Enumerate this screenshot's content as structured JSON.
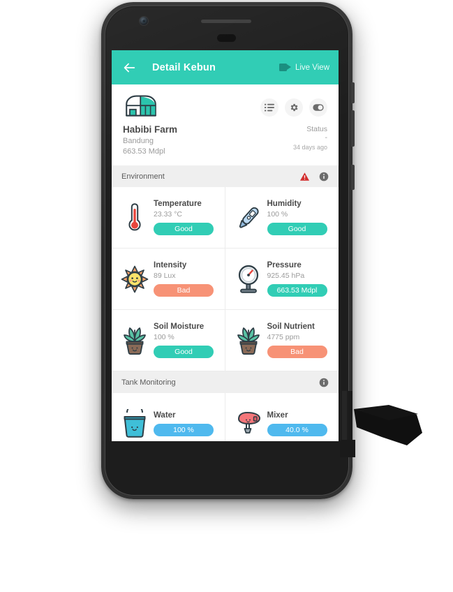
{
  "appbar": {
    "back_icon": "arrow-left-icon",
    "title": "Detail Kebun",
    "live_view_label": "Live View",
    "live_view_icon": "video-camera-icon",
    "bg_color": "#31CDB5"
  },
  "farm": {
    "logo_icon": "greenhouse-icon",
    "name": "Habibi Farm",
    "city": "Bandung",
    "altitude": "663.53 Mdpl",
    "status_label": "Status",
    "status_value": "-",
    "status_ago": "34 days ago",
    "actions": [
      {
        "name": "list-icon",
        "label": "list"
      },
      {
        "name": "gear-icon",
        "label": "settings"
      },
      {
        "name": "toggle-icon",
        "label": "toggle"
      }
    ]
  },
  "sections": [
    {
      "title": "Environment",
      "icons": [
        "warning-triangle-icon",
        "info-icon"
      ],
      "cards": [
        {
          "icon": "thermometer-icon",
          "name": "Temperature",
          "value": "23.33 °C",
          "badge": "Good",
          "badge_type": "good"
        },
        {
          "icon": "hygrometer-icon",
          "name": "Humidity",
          "value": "100 %",
          "badge": "Good",
          "badge_type": "good"
        },
        {
          "icon": "sun-icon",
          "name": "Intensity",
          "value": "89 Lux",
          "badge": "Bad",
          "badge_type": "bad"
        },
        {
          "icon": "gauge-icon",
          "name": "Pressure",
          "value": "925.45 hPa",
          "badge": "663.53 Mdpl",
          "badge_type": "info"
        },
        {
          "icon": "potted-plant-icon",
          "name": "Soil Moisture",
          "value": "100 %",
          "badge": "Good",
          "badge_type": "good"
        },
        {
          "icon": "potted-plant-icon",
          "name": "Soil Nutrient",
          "value": "4775 ppm",
          "badge": "Bad",
          "badge_type": "bad"
        }
      ]
    },
    {
      "title": "Tank Monitoring",
      "icons": [
        "info-icon"
      ],
      "cards": [
        {
          "icon": "bucket-icon",
          "name": "Water",
          "value": "",
          "badge": "100 %",
          "badge_type": "blue"
        },
        {
          "icon": "mixer-icon",
          "name": "Mixer",
          "value": "",
          "badge": "40.0 %",
          "badge_type": "blue"
        }
      ]
    }
  ],
  "colors": {
    "accent": "#31CDB5",
    "bad": "#F79276",
    "blue": "#4FB9EE",
    "warning": "#D32F2F",
    "screen_bg": "#EFEFEF"
  }
}
